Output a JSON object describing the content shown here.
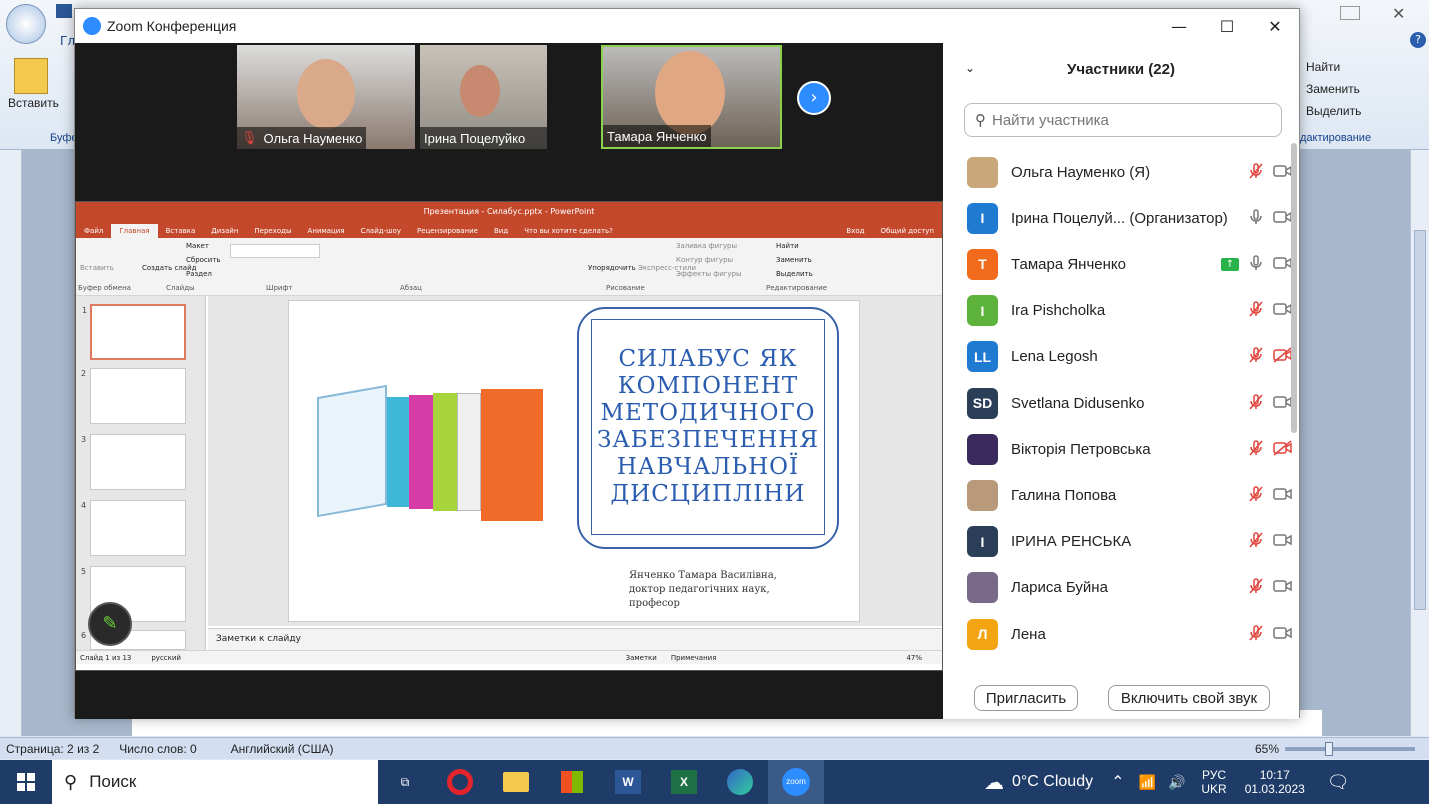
{
  "word": {
    "paste_label": "Вставить",
    "find_label": "Найти",
    "replace_label": "Заменить",
    "select_label": "Выделить",
    "editing_group": "дактирование",
    "buffer_group": "Буфе",
    "tab_fragment": "Гл",
    "status": {
      "page": "Страница: 2 из 2",
      "words": "Число слов: 0",
      "language": "Английский (США)",
      "zoom": "65%"
    }
  },
  "zoom_window": {
    "title": "Zoom Конференция",
    "videos": [
      {
        "name": "Ольга Науменко",
        "muted": true
      },
      {
        "name": "Ірина Поцелуйко",
        "muted": false
      },
      {
        "name": "Тамара Янченко",
        "muted": false,
        "active": true
      }
    ]
  },
  "ppt": {
    "title": "Презентация - Силабус.pptx - PowerPoint",
    "tabs": [
      "Файл",
      "Главная",
      "Вставка",
      "Дизайн",
      "Переходы",
      "Анимация",
      "Слайд-шоу",
      "Рецензирование",
      "Вид"
    ],
    "search_hint": "Что вы хотите сделать?",
    "login": "Вход",
    "share": "Общий доступ",
    "groups": [
      "Буфер обмена",
      "Слайды",
      "Шрифт",
      "Абзац",
      "Рисование",
      "Редактирование"
    ],
    "ribbon": {
      "paste": "Вставить",
      "create_slide": "Создать слайд",
      "layout": "Макет",
      "reset": "Сбросить",
      "section": "Раздел",
      "arrange": "Упорядочить",
      "express_styles": "Экспресс-стили",
      "shape_fill": "Заливка фигуры",
      "shape_outline": "Контур фигуры",
      "shape_effects": "Эффекты фигуры",
      "find": "Найти",
      "replace": "Заменить",
      "select": "Выделить"
    },
    "slide": {
      "title_lines": [
        "СИЛАБУС ЯК",
        "КОМПОНЕНТ",
        "МЕТОДИЧНОГО",
        "ЗАБЕЗПЕЧЕННЯ",
        "НАВЧАЛЬНОЇ",
        "ДИСЦИПЛІНИ"
      ],
      "author_lines": [
        "Янченко Тамара Василівна,",
        "доктор педагогічних наук,",
        "професор"
      ]
    },
    "notes": "Заметки к слайду",
    "status_slide": "Слайд 1 из 13",
    "status_lang": "русский",
    "status_notes": "Заметки",
    "status_comments": "Примечания",
    "status_zoom": "47%",
    "thumb_numbers": [
      "1",
      "2",
      "3",
      "4",
      "5",
      "6"
    ]
  },
  "participants": {
    "header": "Участники (22)",
    "search_placeholder": "Найти участника",
    "list": [
      {
        "name": "Ольга Науменко (Я)",
        "initials": "",
        "color": "#c9a77a",
        "mic": "muted",
        "cam": "on"
      },
      {
        "name": "Ірина Поцелуй... (Организатор)",
        "initials": "I",
        "color": "#1f7ad1",
        "mic": "on",
        "cam": "on"
      },
      {
        "name": "Тамара Янченко",
        "initials": "Т",
        "color": "#f26b1d",
        "mic": "on",
        "cam": "on",
        "sharing": true
      },
      {
        "name": "Ira Pishcholka",
        "initials": "I",
        "color": "#5db33b",
        "mic": "muted",
        "cam": "on"
      },
      {
        "name": "Lena Legosh",
        "initials": "LL",
        "color": "#1f7ad1",
        "mic": "muted",
        "cam": "off"
      },
      {
        "name": "Svetlana Didusenko",
        "initials": "SD",
        "color": "#2b3e58",
        "mic": "muted",
        "cam": "on"
      },
      {
        "name": "Вікторія Петровська",
        "initials": "",
        "color": "#3a2a5c",
        "mic": "muted",
        "cam": "off"
      },
      {
        "name": "Галина Попова",
        "initials": "",
        "color": "#b89a7a",
        "mic": "muted",
        "cam": "on"
      },
      {
        "name": "ІРИНА РЕНСЬКА",
        "initials": "I",
        "color": "#2b3e58",
        "mic": "muted",
        "cam": "on"
      },
      {
        "name": "Лариса Буйна",
        "initials": "",
        "color": "#7a6a8a",
        "mic": "muted",
        "cam": "on"
      },
      {
        "name": "Лена",
        "initials": "Л",
        "color": "#f2a413",
        "mic": "muted",
        "cam": "on"
      }
    ],
    "invite_label": "Пригласить",
    "unmute_label": "Включить свой звук"
  },
  "taskbar": {
    "search_label": "Поиск",
    "weather": "0°C  Cloudy",
    "lang_top": "РУС",
    "lang_bottom": "UKR",
    "time": "10:17",
    "date": "01.03.2023"
  }
}
